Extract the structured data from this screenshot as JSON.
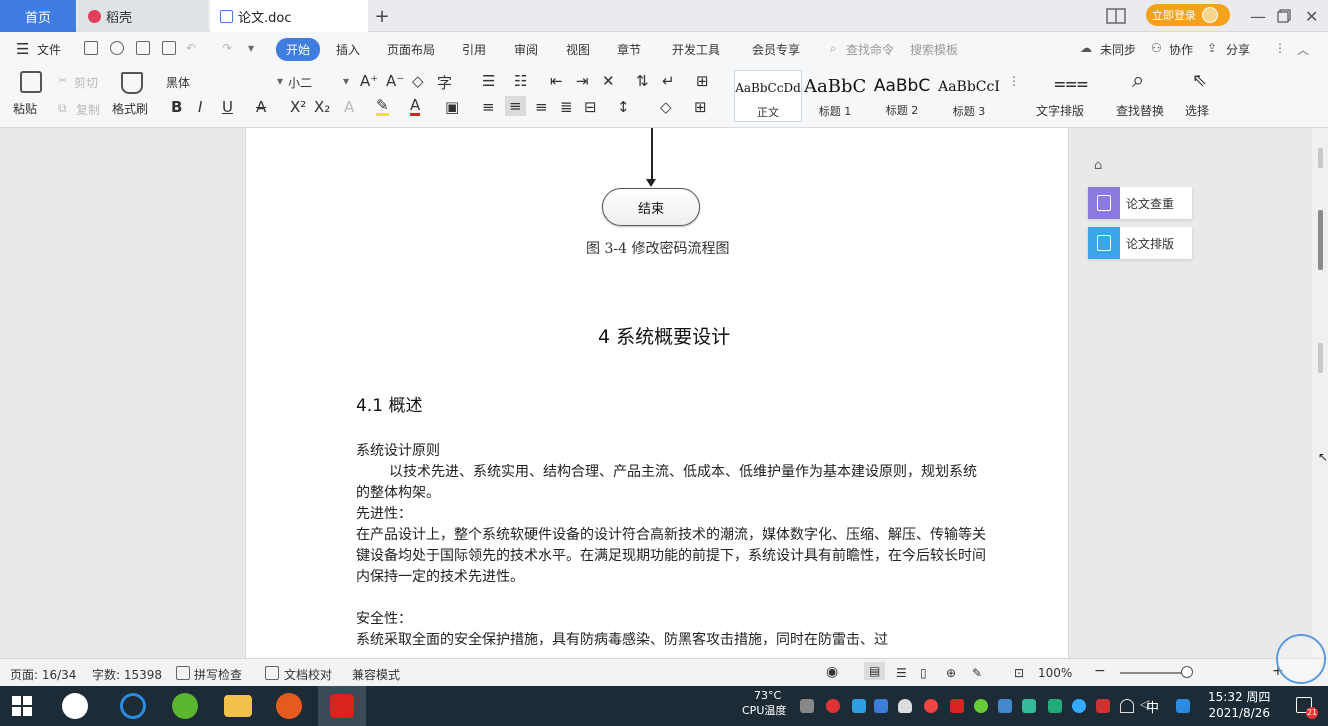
{
  "tabs": {
    "home": "首页",
    "daoke": "稻壳",
    "doc": "论文.doc",
    "new_tab": "+"
  },
  "titlebar": {
    "login_label": "立即登录"
  },
  "menu": {
    "file": "文件",
    "items": [
      "开始",
      "插入",
      "页面布局",
      "引用",
      "审阅",
      "视图",
      "章节",
      "开发工具",
      "会员专享"
    ],
    "search_cmd": "查找命令",
    "search_template": "搜索模板",
    "sync": "未同步",
    "collab": "协作",
    "share": "分享"
  },
  "ribbon": {
    "paste": "粘贴",
    "cut": "剪切",
    "copy": "复制",
    "format_painter": "格式刷",
    "font_name": "黑体",
    "font_size": "小二",
    "styles": [
      {
        "sample": "AaBbCcDd",
        "name": "正文"
      },
      {
        "sample": "AaBbC",
        "name": "标题 1"
      },
      {
        "sample": "AaBbC",
        "name": "标题 2"
      },
      {
        "sample": "AaBbCcI",
        "name": "标题 3"
      }
    ],
    "text_layout": "文字排版",
    "find_replace": "查找替换",
    "select": "选择"
  },
  "document": {
    "flow_end": "结束",
    "figure_caption": "图 3-4 修改密码流程图",
    "chapter_title": "4 系统概要设计",
    "section_title": "4.1 概述",
    "para1_label": "系统设计原则",
    "para1_body": "以技术先进、系统实用、结构合理、产品主流、低成本、低维护量作为基本建设原则，规划系统的整体构架。",
    "para2_label": "先进性：",
    "para2_body": "在产品设计上，整个系统软硬件设备的设计符合高新技术的潮流，媒体数字化、压缩、解压、传输等关键设备均处于国际领先的技术水平。在满足现期功能的前提下，系统设计具有前瞻性，在今后较长时间内保持一定的技术先进性。",
    "para3_label": "安全性：",
    "para3_body": "系统采取全面的安全保护措施，具有防病毒感染、防黑客攻击措施，同时在防雷击、过"
  },
  "sidepanel": {
    "check": "论文查重",
    "format": "论文排版"
  },
  "statusbar": {
    "page": "页面: 16/34",
    "words": "字数: 15398",
    "spellcheck": "拼写检查",
    "proofread": "文档校对",
    "compat": "兼容模式",
    "zoom": "100%"
  },
  "taskbar": {
    "temp": "73°C",
    "cpu": "CPU温度",
    "ime": "中",
    "time": "15:32 周四",
    "date": "2021/8/26"
  },
  "colors": {
    "accent": "#3f7de0",
    "login": "#f4a21c",
    "side_check": "#8a7be0",
    "side_format": "#3aa6e8"
  }
}
